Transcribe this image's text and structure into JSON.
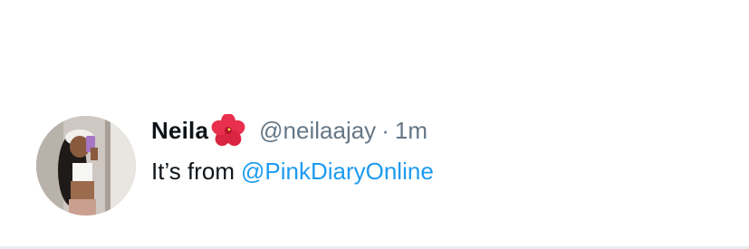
{
  "tweet": {
    "author_name": "Neila",
    "name_emoji": "hibiscus-icon",
    "handle": "@neilaajay",
    "separator": "·",
    "time": "1m",
    "text_prefix": "It’s from",
    "mention": "@PinkDiaryOnline"
  },
  "colors": {
    "text": "#0f1419",
    "muted": "#657786",
    "link": "#1d9bf0",
    "flower": "#e8304e"
  }
}
